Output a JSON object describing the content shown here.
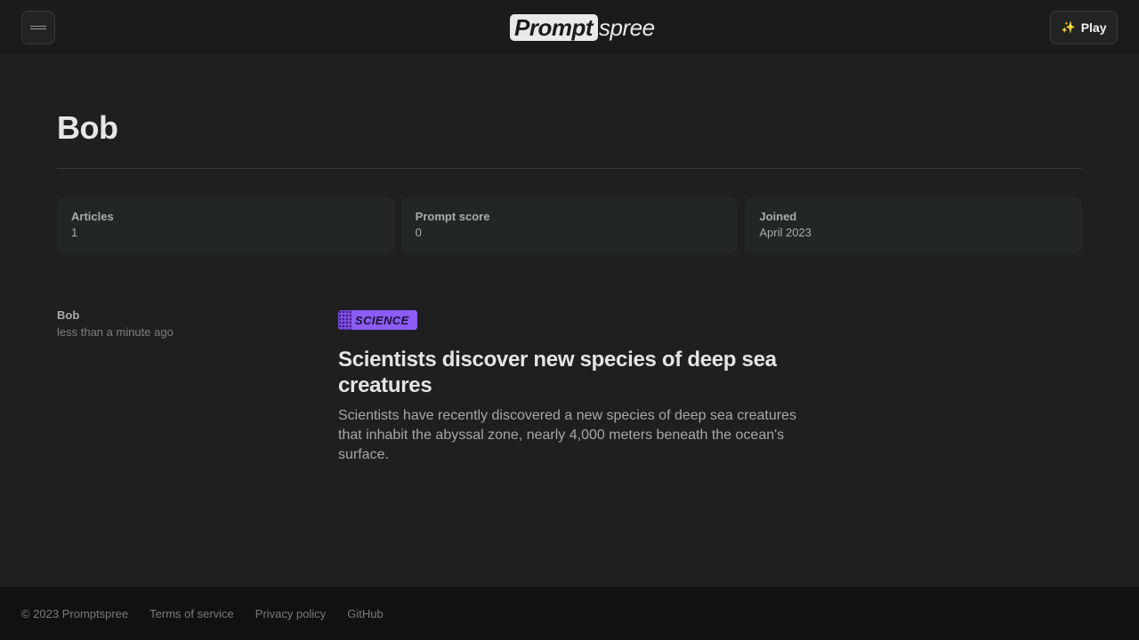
{
  "header": {
    "logo_main": "Prompt",
    "logo_suffix": "spree",
    "play_label": "Play",
    "play_icon": "sparkles-icon"
  },
  "profile": {
    "name": "Bob",
    "stats": [
      {
        "label": "Articles",
        "value": "1"
      },
      {
        "label": "Prompt score",
        "value": "0"
      },
      {
        "label": "Joined",
        "value": "April 2023"
      }
    ]
  },
  "article": {
    "author": "Bob",
    "posted": "less than a minute ago",
    "tag": "SCIENCE",
    "title": "Scientists discover new species of deep sea creatures",
    "summary": "Scientists have recently discovered a new species of deep sea creatures that inhabit the abyssal zone, nearly 4,000 meters beneath the ocean's surface."
  },
  "footer": {
    "copyright": "© 2023 Promptspree",
    "links": [
      "Terms of service",
      "Privacy policy",
      "GitHub"
    ]
  },
  "colors": {
    "background": "#1f1f1f",
    "tag_accent": "#8b5cf6",
    "card": "#232626",
    "footer": "#111111"
  }
}
